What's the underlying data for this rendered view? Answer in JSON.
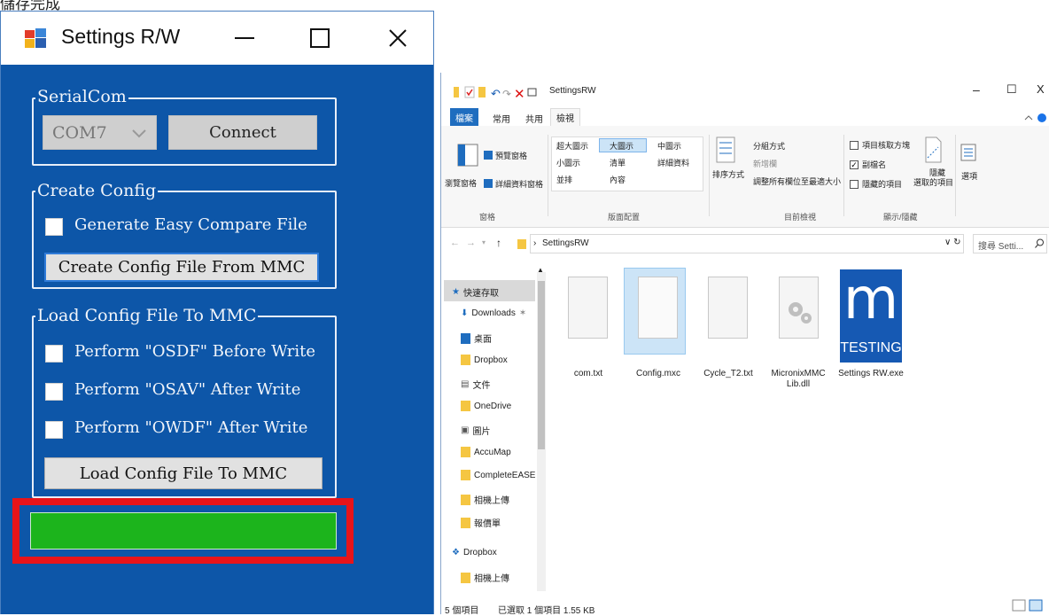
{
  "caption": "儲存完成",
  "settings_window": {
    "title": "Settings R/W",
    "controls": {
      "minimize": "—",
      "maximize": "☐",
      "close": "✕"
    },
    "serialcom": {
      "group_title": "SerialCom",
      "port_value": "COM7",
      "connect_label": "Connect"
    },
    "create_config": {
      "group_title": "Create Config",
      "easy_compare_label": "Generate Easy Compare File",
      "create_button": "Create Config File From MMC"
    },
    "load_config": {
      "group_title": "Load Config File To MMC",
      "osdf_label": "Perform \"OSDF\" Before Write",
      "osav_label": "Perform \"OSAV\" After Write",
      "owdf_label": "Perform \"OWDF\" After Write",
      "load_button": "Load Config File To MMC"
    },
    "progress_percent": 100,
    "colors": {
      "body": "#0d56a8",
      "progress": "#1cb41c",
      "highlight": "#e8141a"
    }
  },
  "explorer": {
    "title": "SettingsRW",
    "window_controls": {
      "minimize": "–",
      "maximize": "☐",
      "close": "X"
    },
    "tabs": {
      "file": "檔案",
      "home": "常用",
      "share": "共用",
      "view": "檢視"
    },
    "ribbon": {
      "pane_group": {
        "nav_pane": "瀏覽窗格",
        "preview_pane": "預覽窗格",
        "details_pane": "詳細資料窗格",
        "label": "窗格"
      },
      "layout_group": {
        "extra_large": "超大圖示",
        "large": "大圖示",
        "medium": "中圖示",
        "small": "小圖示",
        "list": "清單",
        "details": "詳細資料",
        "tiles": "並排",
        "content": "內容",
        "label": "版面配置"
      },
      "view_group": {
        "sort_by": "排序方式",
        "group_by": "分組方式",
        "add_columns": "新增欄",
        "size_all": "調整所有欄位至最適大小",
        "label": "目前檢視"
      },
      "showhide_group": {
        "item_checkboxes": "項目核取方塊",
        "extensions": "副檔名",
        "hidden_items": "隱藏的項目",
        "hide_selected": "隱藏",
        "hide_selected_2": "選取的項目",
        "label": "顯示/隱藏"
      },
      "options": "選項"
    },
    "address": {
      "crumb": "SettingsRW"
    },
    "search_placeholder": "搜尋 Setti...",
    "nav_items": [
      "快速存取",
      "Downloads",
      "桌面",
      "Dropbox",
      "文件",
      "OneDrive",
      "圖片",
      "AccuMap",
      "CompleteEASE",
      "相機上傳",
      "報價單",
      "Dropbox",
      "相機上傳"
    ],
    "files": [
      "com.txt",
      "Config.mxc",
      "Cycle_T2.txt",
      "MicronixMMCLib.dll",
      "Settings RW.exe"
    ],
    "exe_icon_letter": "m",
    "exe_icon_text": "TESTING",
    "status": {
      "count": "5 個項目",
      "selected": "已選取 1 個項目 1.55 KB"
    }
  }
}
